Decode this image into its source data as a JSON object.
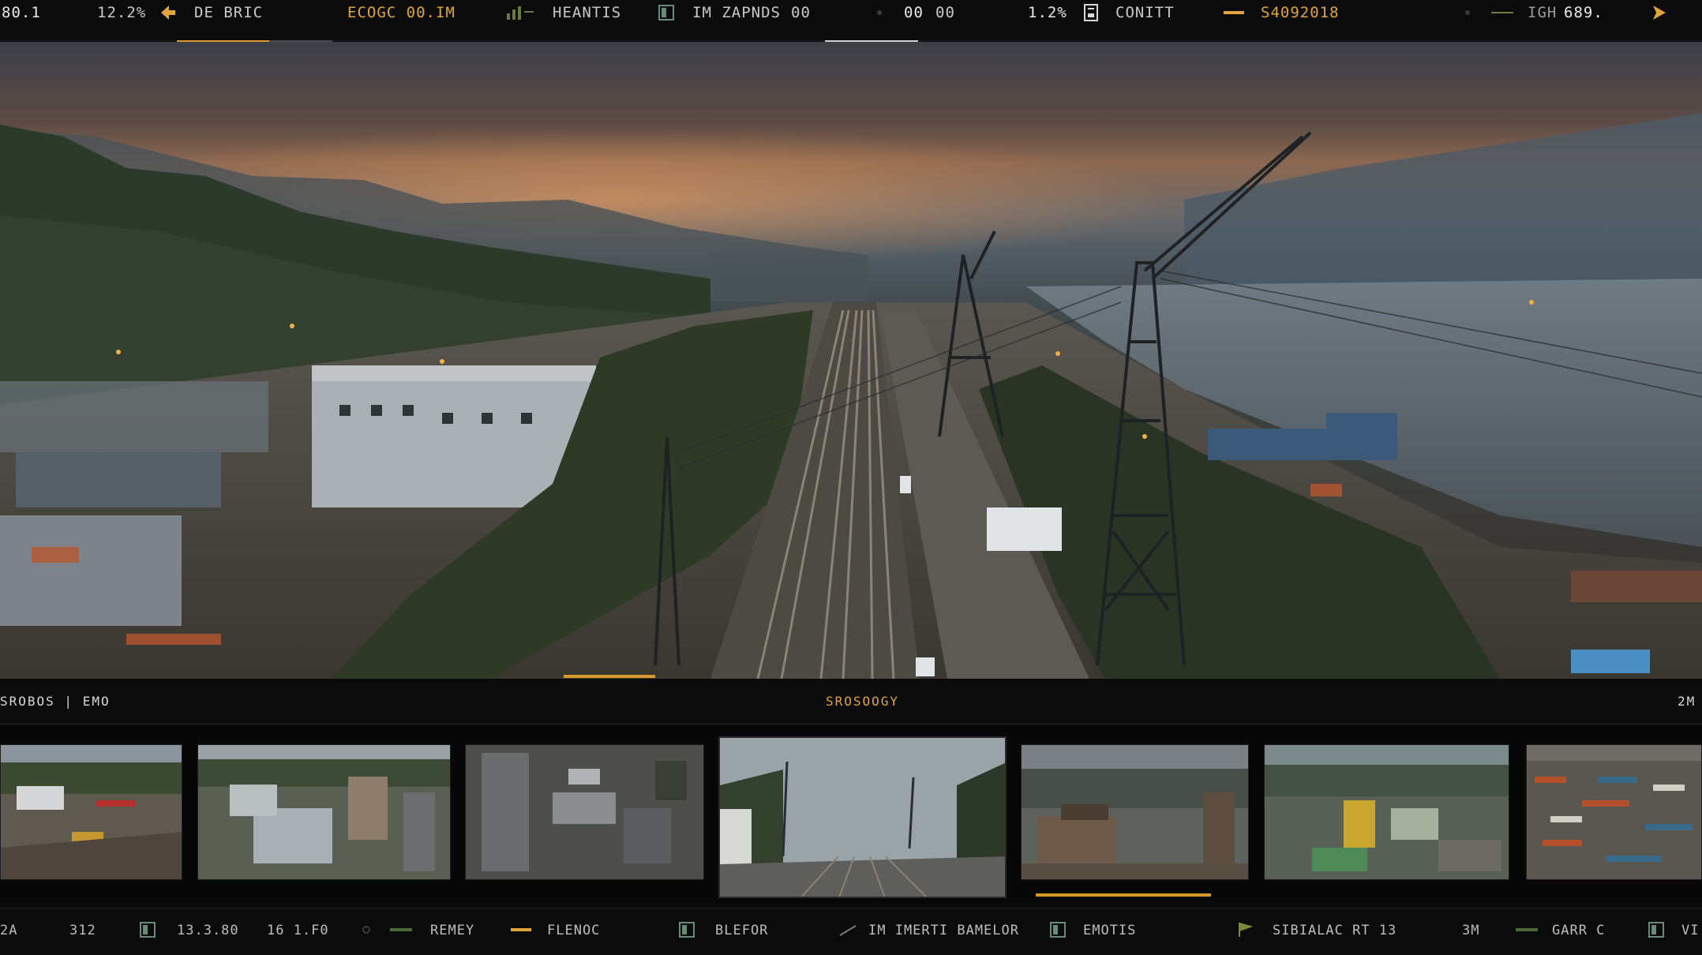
{
  "top_bar": {
    "items": [
      {
        "text": "80.1"
      },
      {
        "text": "12.2%"
      },
      {
        "text": "DE BRIC"
      },
      {
        "text": "ECOGC 00.IM"
      },
      {
        "text": "HEANTIS"
      },
      {
        "text": "IM  ZAPNDS"
      },
      {
        "text": "00"
      },
      {
        "text": "00"
      },
      {
        "text": "00"
      },
      {
        "text": "1.2%"
      },
      {
        "text": "CONITT"
      },
      {
        "text": "S4092018"
      },
      {
        "text": "IGH"
      },
      {
        "text": "689."
      }
    ],
    "icons": [
      "back-arrow-icon",
      "signal-icon",
      "panel-icon",
      "dot-icon",
      "document-icon",
      "dash-icon",
      "dot-icon",
      "dash-icon",
      "forward-arrow-icon"
    ]
  },
  "viewport": {
    "scene": "industrial-port-railway-aerial"
  },
  "filmstrip": {
    "left_label": "SROBOS | EMO",
    "center_label": "SROSOOGY",
    "right_label": "2M",
    "thumbnails": [
      {
        "scene": "construction-yard"
      },
      {
        "scene": "white-roof-buildings"
      },
      {
        "scene": "aerial-parking-trucks"
      },
      {
        "scene": "railway-towers"
      },
      {
        "scene": "old-building-ruins"
      },
      {
        "scene": "shipyard-cranes"
      },
      {
        "scene": "container-terminal"
      }
    ],
    "selected_index": 3
  },
  "bottom_bar": {
    "items": [
      {
        "text": "2A"
      },
      {
        "text": "312"
      },
      {
        "text": "13.3.80"
      },
      {
        "text": "16 1.F0"
      },
      {
        "text": "REMEY"
      },
      {
        "text": "FLENOC"
      },
      {
        "text": "BLEFOR"
      },
      {
        "text": "IM  IMERTI  BAMELOR"
      },
      {
        "text": "EMOTIS"
      },
      {
        "text": "SIBIALAC  RT  13"
      },
      {
        "text": "3M"
      },
      {
        "text": "GARR  C"
      },
      {
        "text": "VI"
      }
    ]
  },
  "colors": {
    "accent": "#e0a53a",
    "background": "#0b0b0b",
    "text": "#cfcfcf"
  }
}
